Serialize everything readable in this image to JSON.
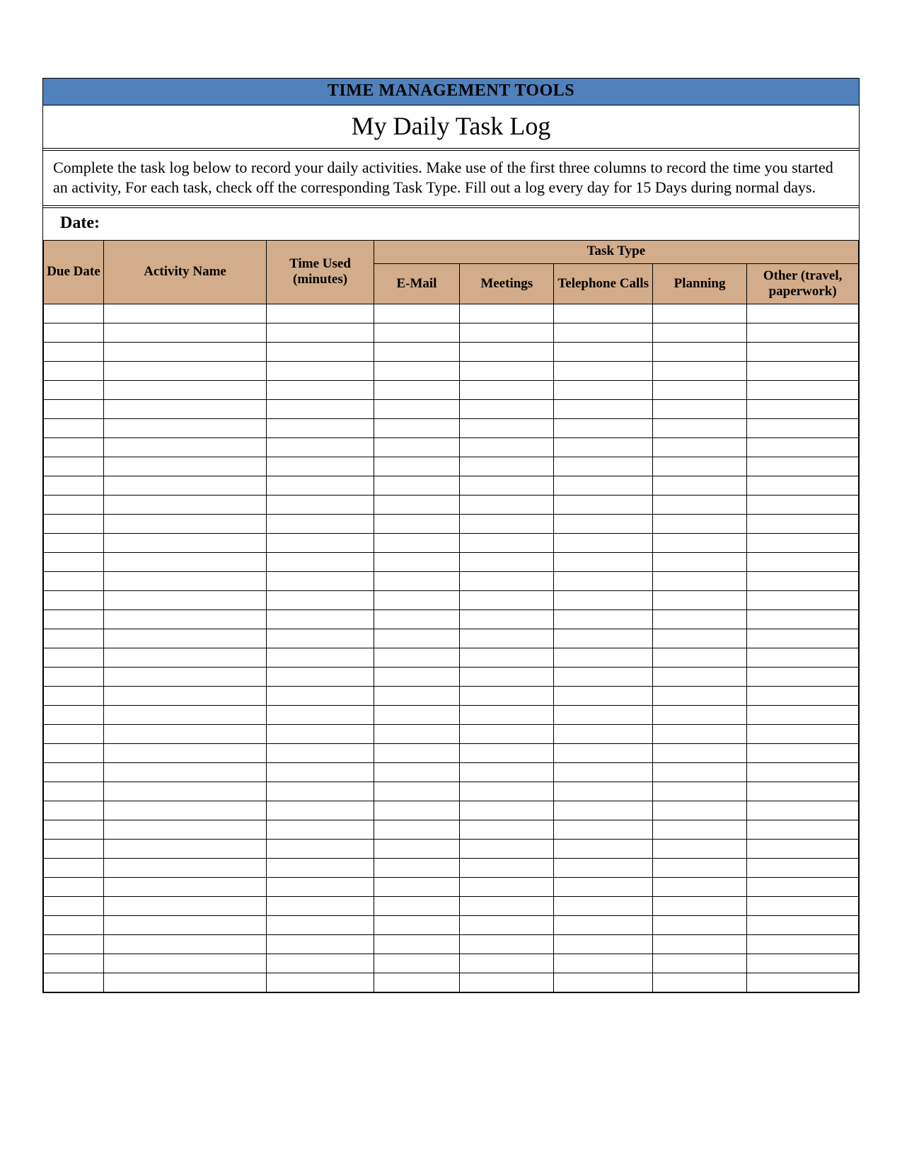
{
  "header": {
    "banner": "TIME MANAGEMENT TOOLS",
    "title": "My Daily Task Log"
  },
  "instructions": "Complete the task log below to record your daily activities. Make use of the first three columns to record the time you started an activity, For each task, check off the corresponding Task Type. Fill out a log every day for 15 Days during normal days.",
  "date_label": "Date:",
  "columns": {
    "due_date": "Due Date",
    "activity_name": "Activity Name",
    "time_used": "Time Used (minutes)",
    "task_type_group": "Task Type",
    "email": "E-Mail",
    "meetings": "Meetings",
    "telephone": "Telephone Calls",
    "planning": "Planning",
    "other": "Other (travel, paperwork)"
  },
  "row_count": 36
}
